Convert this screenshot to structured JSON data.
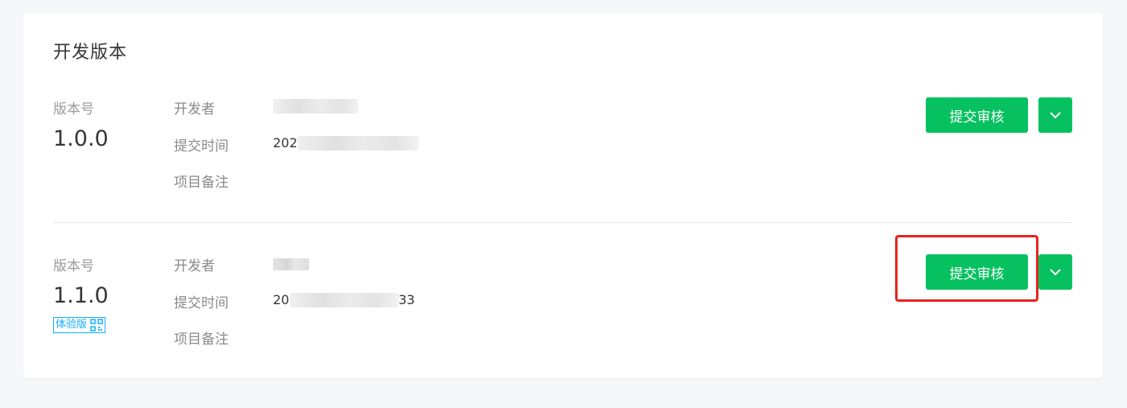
{
  "section": {
    "title": "开发版本"
  },
  "versions": [
    {
      "version_label": "版本号",
      "version": "1.0.0",
      "tag": null,
      "fields": [
        {
          "label": "开发者",
          "value": ""
        },
        {
          "label": "提交时间",
          "value": "202"
        },
        {
          "label": "项目备注",
          "value": ""
        }
      ],
      "submit_label": "提交审核"
    },
    {
      "version_label": "版本号",
      "version": "1.1.0",
      "tag": "体验版",
      "fields": [
        {
          "label": "开发者",
          "value": ""
        },
        {
          "label": "提交时间",
          "value": "20",
          "value_suffix": "33"
        },
        {
          "label": "项目备注",
          "value": ""
        }
      ],
      "submit_label": "提交审核"
    }
  ],
  "colors": {
    "accent": "#07c160",
    "tag": "#10aeff",
    "highlight": "#e8231f"
  },
  "icons": {
    "more": "chevron-down-icon",
    "qr": "qrcode-icon"
  }
}
